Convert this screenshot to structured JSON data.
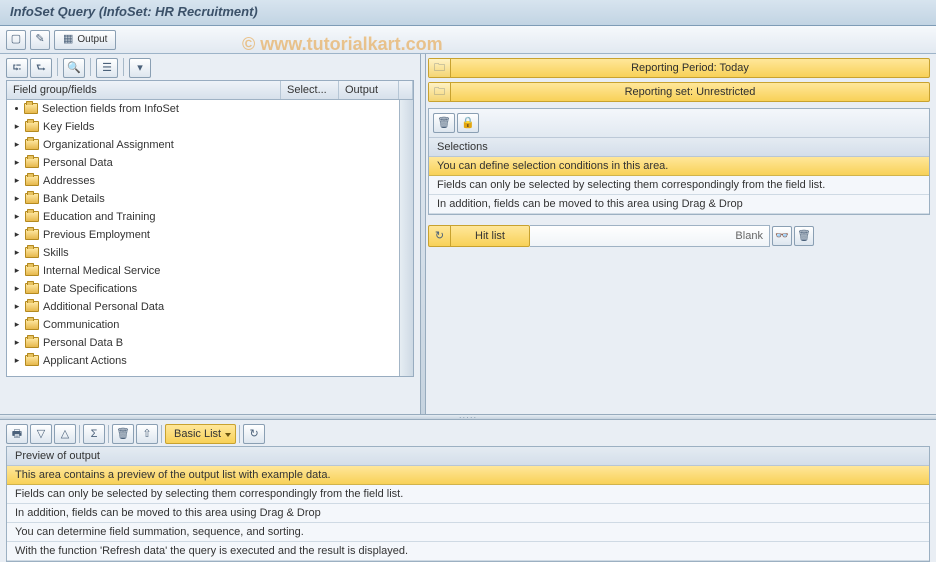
{
  "title": "InfoSet Query (InfoSet: HR Recruitment)",
  "watermark": "© www.tutorialkart.com",
  "main_toolbar": {
    "output_label": "Output"
  },
  "tree": {
    "header": {
      "name": "Field group/fields",
      "select": "Select...",
      "output": "Output"
    },
    "items": [
      "Selection fields from InfoSet",
      "Key Fields",
      "Organizational Assignment",
      "Personal Data",
      "Addresses",
      "Bank Details",
      "Education and Training",
      "Previous Employment",
      "Skills",
      "Internal Medical Service",
      "Date Specifications",
      "Additional Personal Data",
      "Communication",
      "Personal Data  B",
      "Applicant Actions"
    ]
  },
  "reporting": {
    "period": "Reporting Period: Today",
    "set": "Reporting set: Unrestricted"
  },
  "selections": {
    "title": "Selections",
    "highlight": "You can define selection conditions in this area.",
    "line1": "Fields can only be selected by selecting them correspondingly from the field list.",
    "line2": "In addition, fields can be moved to this area using Drag & Drop"
  },
  "hitlist": {
    "label": "Hit list",
    "value": "Blank"
  },
  "preview_toolbar": {
    "basic_list": "Basic List"
  },
  "preview": {
    "title": "Preview of output",
    "highlight": "This area contains a preview of the output list with example data.",
    "lines": [
      "Fields can only be selected by selecting them correspondingly from the field list.",
      "In addition, fields can be moved to this area using Drag & Drop",
      "You can determine field summation, sequence, and sorting.",
      "With the function 'Refresh data' the query is executed and the result is displayed."
    ]
  }
}
